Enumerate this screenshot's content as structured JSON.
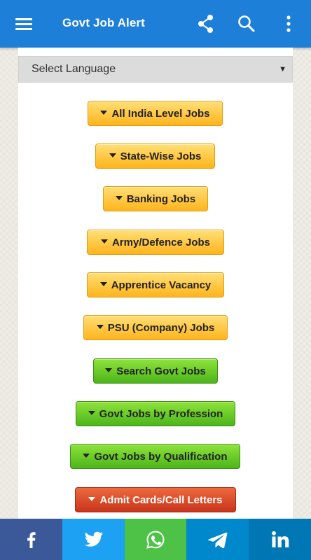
{
  "appbar": {
    "title": "Govt Job Alert",
    "color": "#1e7fd8",
    "icons": [
      "menu-icon",
      "share-icon",
      "search-icon",
      "more-vert-icon"
    ]
  },
  "language_select": {
    "selected": "Select Language"
  },
  "job_links": [
    {
      "label": "All India Level Jobs",
      "color": "yellow"
    },
    {
      "label": "State-Wise Jobs",
      "color": "yellow"
    },
    {
      "label": "Banking Jobs",
      "color": "yellow"
    },
    {
      "label": "Army/Defence Jobs",
      "color": "yellow"
    },
    {
      "label": "Apprentice Vacancy",
      "color": "yellow"
    },
    {
      "label": "PSU (Company) Jobs",
      "color": "yellow"
    },
    {
      "label": "Search Govt Jobs",
      "color": "green"
    },
    {
      "label": "Govt Jobs by Profession",
      "color": "green"
    },
    {
      "label": "Govt Jobs by Qualification",
      "color": "green"
    },
    {
      "label": "Admit Cards/Call Letters",
      "color": "red"
    }
  ],
  "share_bar": [
    {
      "icon": "facebook-icon",
      "color": "#3b5998"
    },
    {
      "icon": "twitter-icon",
      "color": "#1da1f2"
    },
    {
      "icon": "whatsapp-icon",
      "color": "#4dc247"
    },
    {
      "icon": "telegram-icon",
      "color": "#0088cc"
    },
    {
      "icon": "linkedin-icon",
      "color": "#0077b5"
    }
  ]
}
